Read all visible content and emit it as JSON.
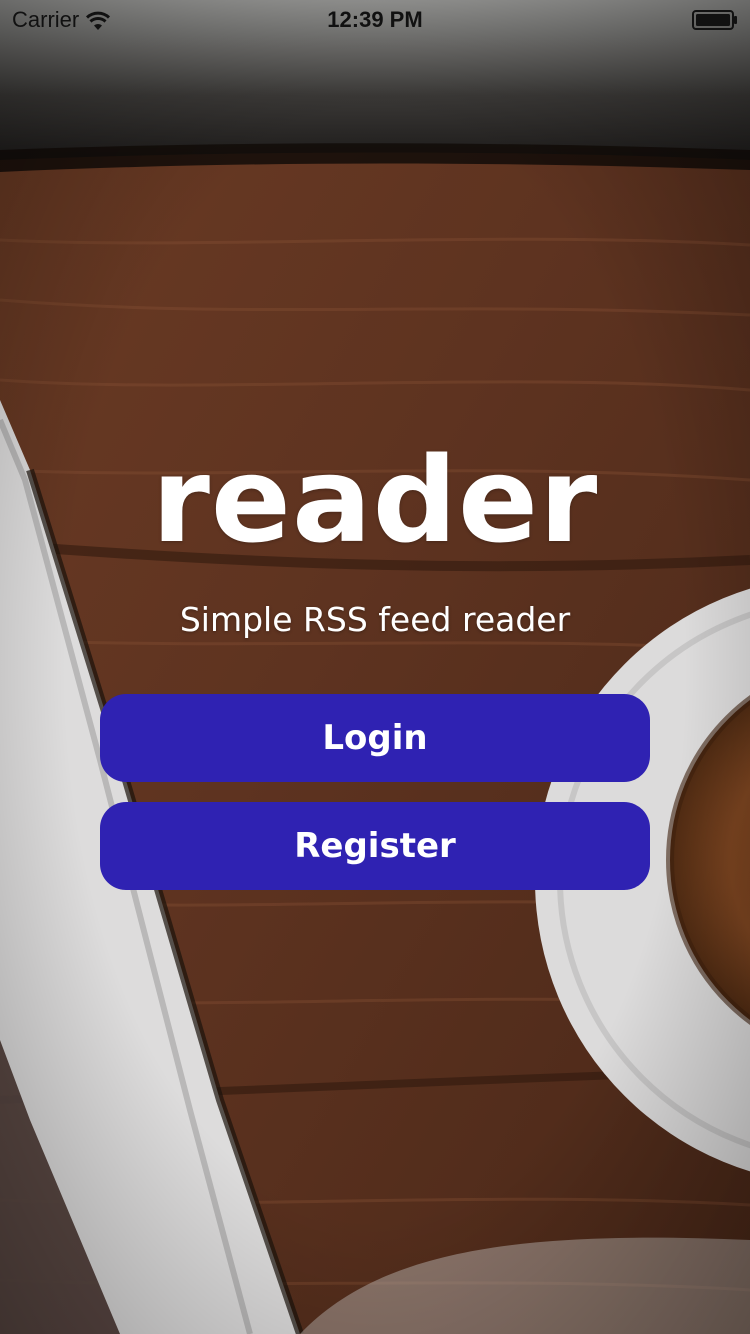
{
  "status_bar": {
    "carrier": "Carrier",
    "time": "12:39 PM",
    "wifi_icon": "wifi-icon",
    "battery_icon": "battery-icon"
  },
  "app": {
    "title": "reader",
    "subtitle": "Simple RSS feed reader"
  },
  "actions": {
    "login_label": "Login",
    "register_label": "Register"
  },
  "colors": {
    "button_background": "#2f22b2",
    "button_text": "#ffffff",
    "title_text": "#ffffff"
  }
}
